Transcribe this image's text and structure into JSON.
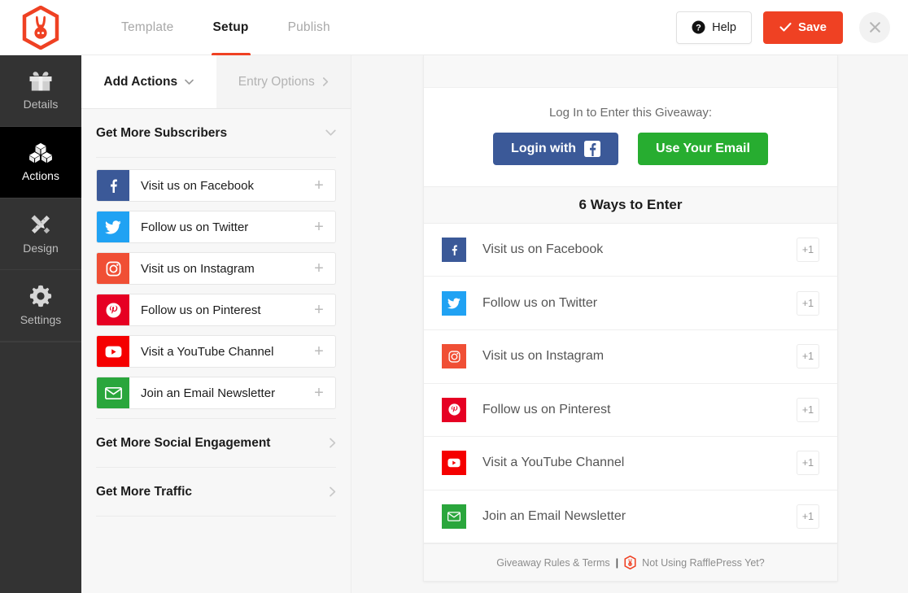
{
  "brand": {
    "logo_icon": "rabbit-hexagon-logo",
    "accent_color": "#ef4123"
  },
  "header": {
    "tabs": [
      {
        "label": "Template",
        "active": false
      },
      {
        "label": "Setup",
        "active": true
      },
      {
        "label": "Publish",
        "active": false
      }
    ],
    "help_label": "Help",
    "help_icon": "question-circle-icon",
    "save_label": "Save",
    "save_icon": "check-icon",
    "close_icon": "close-icon"
  },
  "rail": {
    "items": [
      {
        "label": "Details",
        "icon": "gift-icon",
        "active": false
      },
      {
        "label": "Actions",
        "icon": "cubes-icon",
        "active": true
      },
      {
        "label": "Design",
        "icon": "pencil-ruler-icon",
        "active": false
      },
      {
        "label": "Settings",
        "icon": "gear-icon",
        "active": false
      }
    ]
  },
  "panel": {
    "tabs": [
      {
        "label": "Add Actions",
        "icon": "chevron-down-icon",
        "active": true
      },
      {
        "label": "Entry Options",
        "icon": "chevron-right-icon",
        "active": false
      }
    ],
    "groups": [
      {
        "title": "Get More Subscribers",
        "icon": "chevron-down-icon",
        "expanded": true
      },
      {
        "title": "Get More Social Engagement",
        "icon": "chevron-right-icon",
        "expanded": false
      },
      {
        "title": "Get More Traffic",
        "icon": "chevron-right-icon",
        "expanded": false
      }
    ],
    "actions": [
      {
        "label": "Visit us on Facebook",
        "icon": "facebook-icon",
        "color": "#3b5998",
        "add_icon": "plus-icon"
      },
      {
        "label": "Follow us on Twitter",
        "icon": "twitter-icon",
        "color": "#20a2f3",
        "add_icon": "plus-icon"
      },
      {
        "label": "Visit us on Instagram",
        "icon": "instagram-icon",
        "color": "#f04f35",
        "add_icon": "plus-icon"
      },
      {
        "label": "Follow us on Pinterest",
        "icon": "pinterest-icon",
        "color": "#e60023",
        "add_icon": "plus-icon"
      },
      {
        "label": "Visit a YouTube Channel",
        "icon": "youtube-icon",
        "color": "#f50000",
        "add_icon": "plus-icon"
      },
      {
        "label": "Join an Email Newsletter",
        "icon": "envelope-icon",
        "color": "#2aa63c",
        "add_icon": "plus-icon"
      }
    ]
  },
  "preview": {
    "login_prompt": "Log In to Enter this Giveaway:",
    "login_facebook_label": "Login with",
    "login_facebook_icon": "facebook-icon",
    "login_email_label": "Use Your Email",
    "ways_title": "6 Ways to Enter",
    "entries": [
      {
        "label": "Visit us on Facebook",
        "icon": "facebook-icon",
        "color": "#3b5998",
        "points": "+1"
      },
      {
        "label": "Follow us on Twitter",
        "icon": "twitter-icon",
        "color": "#20a2f3",
        "points": "+1"
      },
      {
        "label": "Visit us on Instagram",
        "icon": "instagram-icon",
        "color": "#f04f35",
        "points": "+1"
      },
      {
        "label": "Follow us on Pinterest",
        "icon": "pinterest-icon",
        "color": "#e60023",
        "points": "+1"
      },
      {
        "label": "Visit a YouTube Channel",
        "icon": "youtube-icon",
        "color": "#f50000",
        "points": "+1"
      },
      {
        "label": "Join an Email Newsletter",
        "icon": "envelope-icon",
        "color": "#2aa63c",
        "points": "+1"
      }
    ],
    "footer": {
      "rules_label": "Giveaway Rules & Terms",
      "separator": "|",
      "logo_icon": "rabbit-hexagon-logo",
      "promo_label": "Not Using RafflePress Yet?"
    }
  }
}
